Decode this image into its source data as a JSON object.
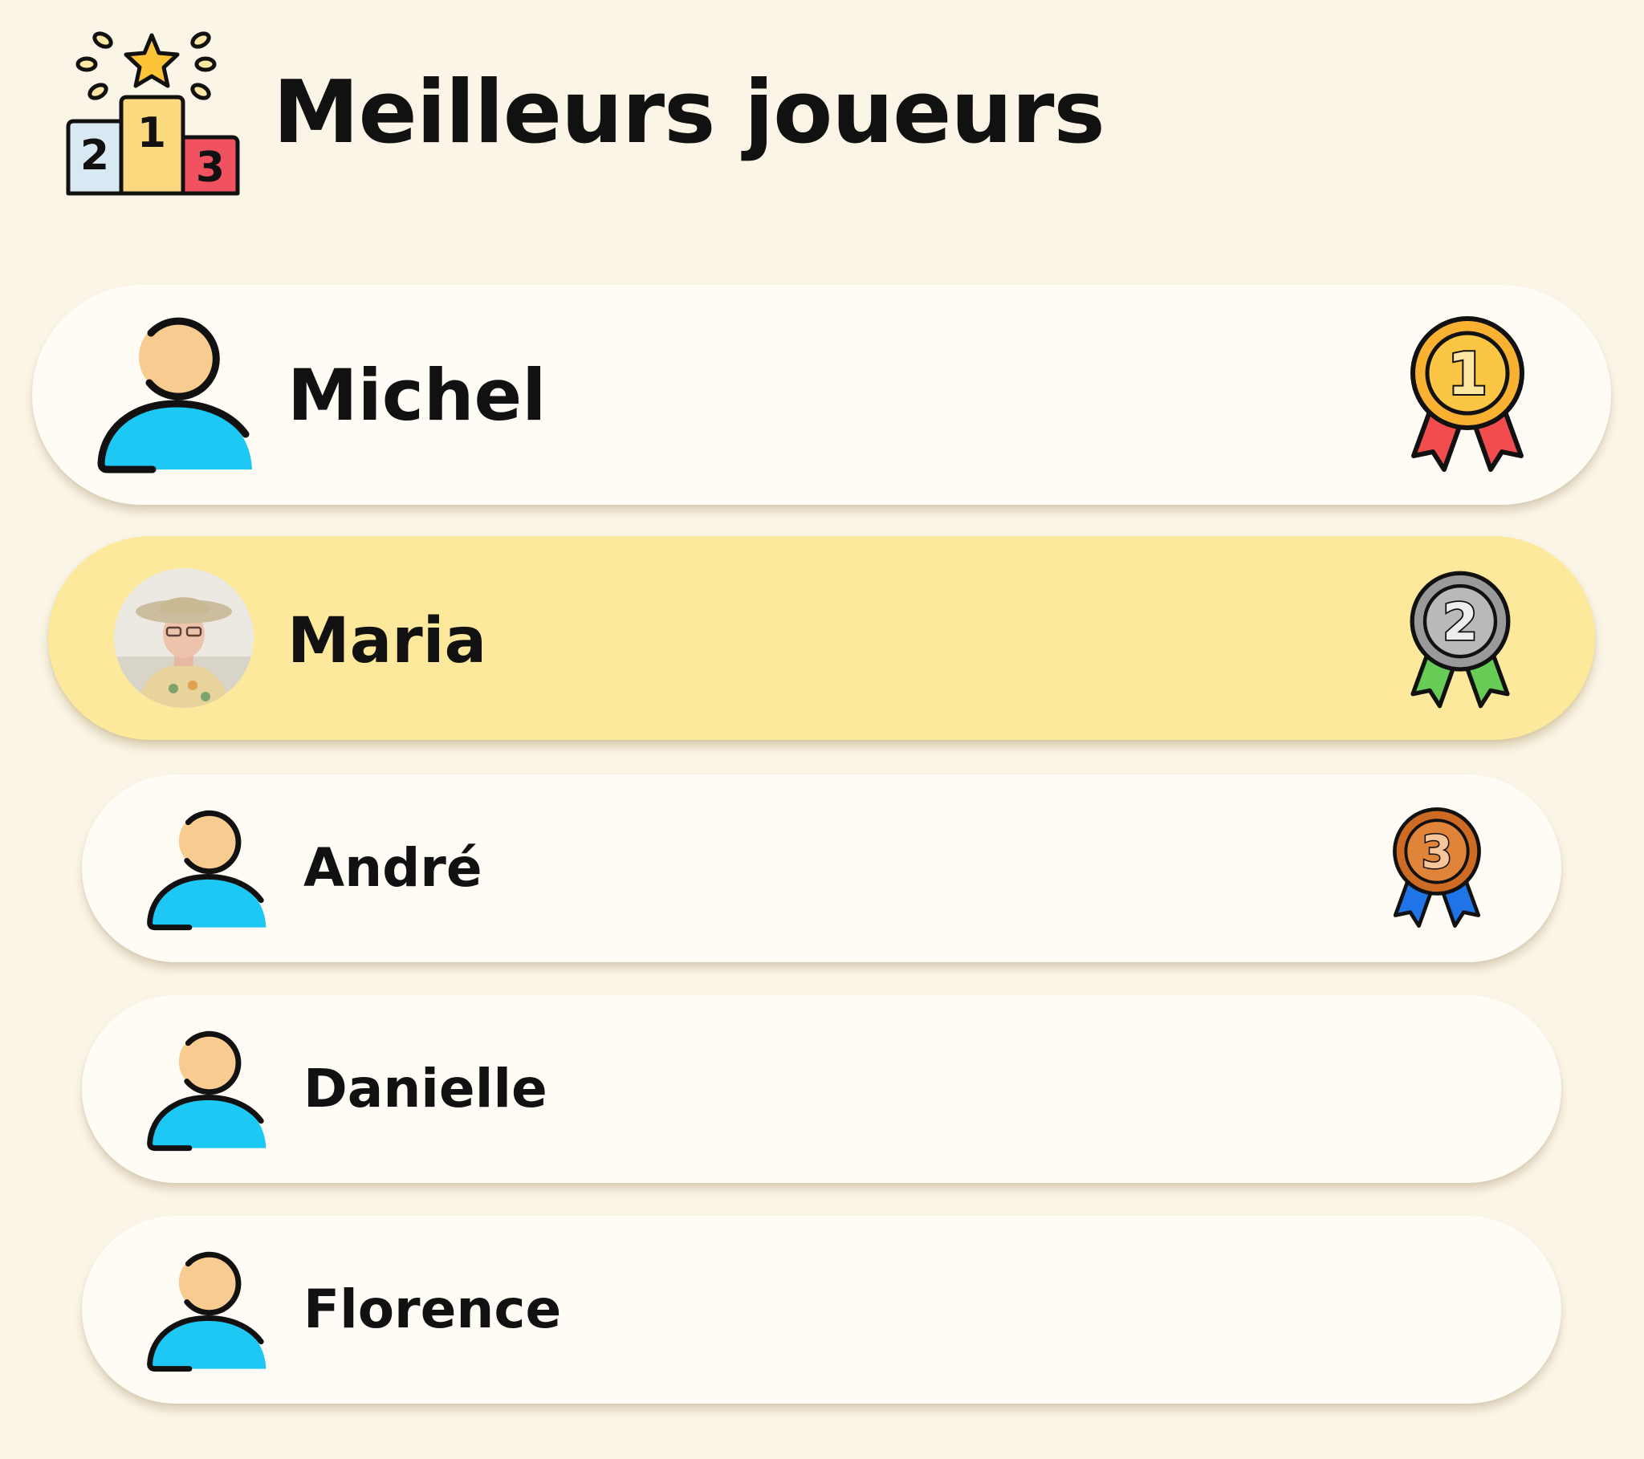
{
  "header": {
    "title": "Meilleurs joueurs",
    "icon": "podium-icon",
    "podium_numbers": [
      "2",
      "1",
      "3"
    ]
  },
  "players": [
    {
      "name": "Michel",
      "avatar": "user-icon",
      "medal": "gold-medal-icon",
      "medal_number": "1",
      "highlighted": false
    },
    {
      "name": "Maria",
      "avatar": "profile-photo",
      "medal": "silver-medal-icon",
      "medal_number": "2",
      "highlighted": true
    },
    {
      "name": "André",
      "avatar": "user-icon",
      "medal": "bronze-medal-icon",
      "medal_number": "3",
      "highlighted": false
    },
    {
      "name": "Danielle",
      "avatar": "user-icon",
      "medal": null,
      "medal_number": null,
      "highlighted": false
    },
    {
      "name": "Florence",
      "avatar": "user-icon",
      "medal": null,
      "medal_number": null,
      "highlighted": false
    }
  ],
  "colors": {
    "background": "#fbf5e7",
    "card": "#fefcf5",
    "highlight_card": "#fce99b",
    "avatar_body": "#1ec8f5",
    "avatar_head": "#f8cb91",
    "gold": "#f9b131",
    "silver": "#9a9a9a",
    "bronze": "#cd6a23",
    "ribbon_red": "#f24c4f",
    "ribbon_green": "#66cc55",
    "ribbon_blue": "#1f74e8"
  }
}
